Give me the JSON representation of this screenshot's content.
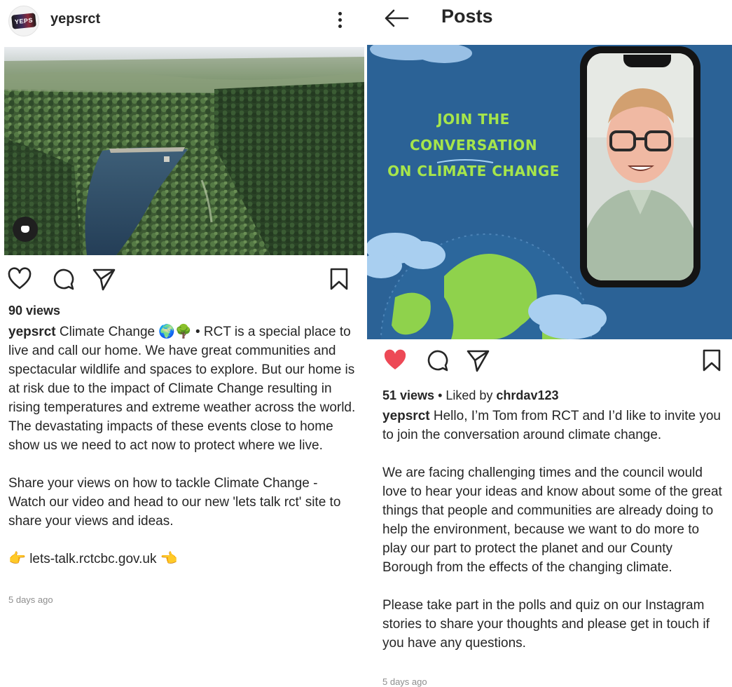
{
  "left_post": {
    "username": "yepsrct",
    "avatar_text": "YEPS",
    "views": "90 views",
    "caption_user": "yepsrct",
    "caption_para1": "Climate Change 🌍🌳 • RCT is a special place to live and call our home. We have great communities and spectacular wildlife and spaces to explore. But our home is at risk due to the impact of Climate Change resulting in rising temperatures and extreme weather across the world. The devastating impacts of these events close to home show us we need to act now to protect where we live.",
    "caption_para2": "Share your views on how to tackle Climate Change - Watch our video and head to our new 'lets talk rct' site to share your views and ideas.",
    "link_prefix": "👉",
    "link_text": "lets-talk.rctcbc.gov.uk",
    "link_suffix": "👈",
    "timestamp": "5 days ago"
  },
  "right_post": {
    "header_title": "Posts",
    "banner_line1": "JOIN THE CONVERSATION",
    "banner_line2": "ON CLIMATE CHANGE",
    "views": "51 views",
    "liked_by_prefix": " • Liked by ",
    "liked_by_user": "chrdav123",
    "caption_user": "yepsrct",
    "caption_para1": "Hello, I’m Tom from RCT and I’d like to invite you to join the conversation around climate change.",
    "caption_para2": "We are facing challenging times and the council would love to hear your ideas and know about some of the great things that people and communities are already doing to help the environment, because we want to do more to play our part to protect the planet and our County Borough from the effects of the changing climate.",
    "caption_para3": "Please take part in the polls and quiz on our Instagram stories to share your thoughts and please get in touch if you have any questions.",
    "timestamp": "5 days ago"
  },
  "icons": {
    "like": "heart-icon",
    "liked": "heart-filled-icon",
    "comment": "comment-icon",
    "share": "send-icon",
    "save": "bookmark-icon",
    "more": "more-vertical-icon",
    "back": "arrow-left-icon",
    "audio": "audio-icon"
  },
  "colors": {
    "liked_heart": "#ed4956",
    "banner_bg": "#2b6296",
    "banner_text": "#a6e54b",
    "muted_text": "#8e8e8e"
  }
}
